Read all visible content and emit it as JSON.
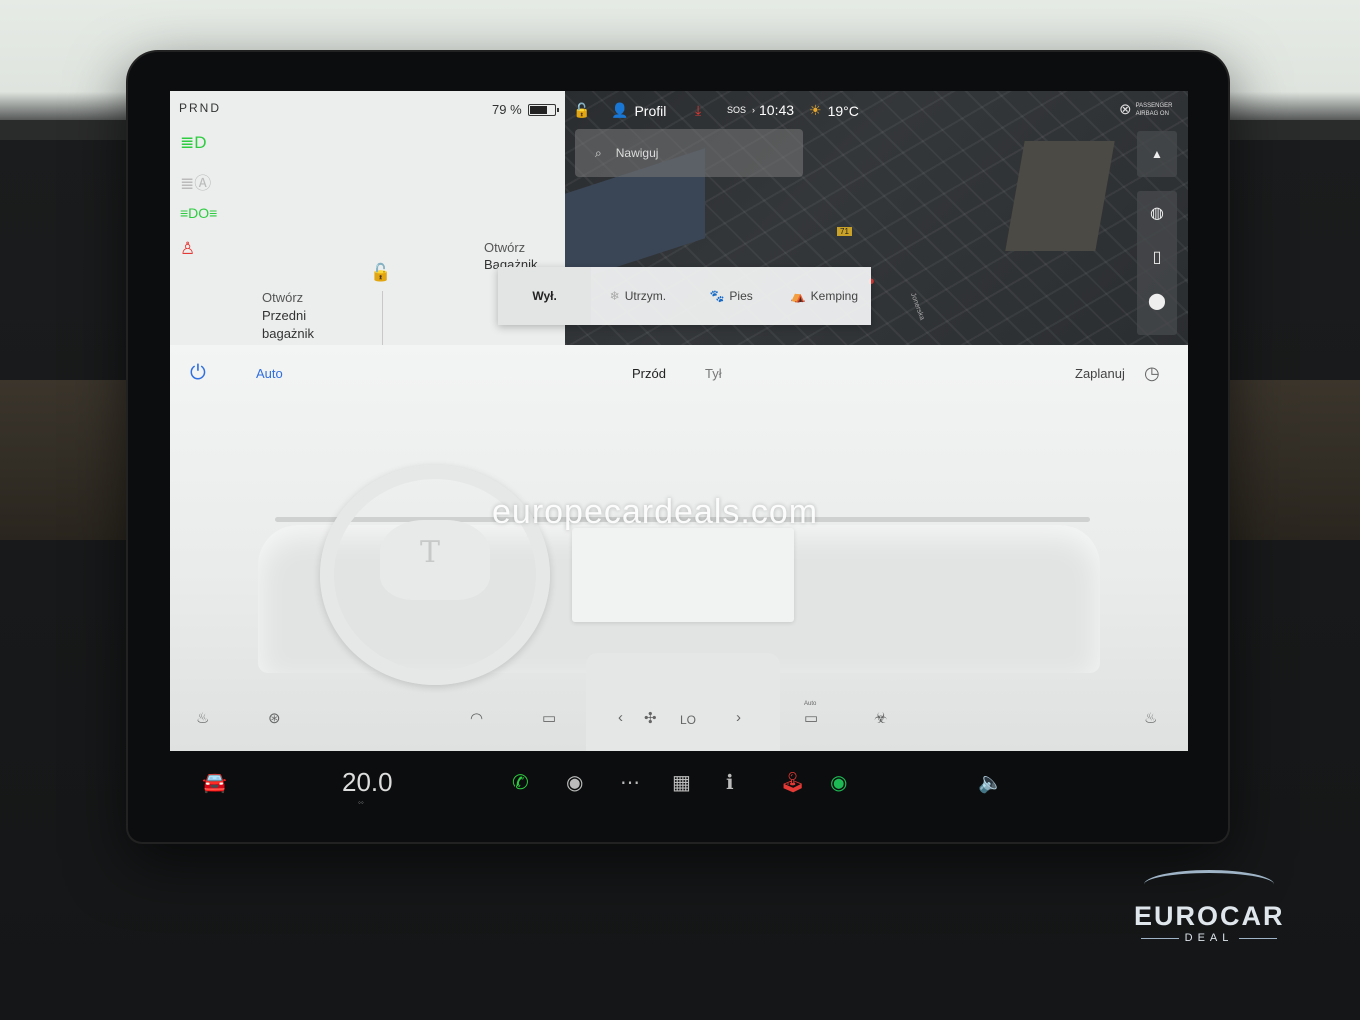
{
  "car_panel": {
    "gear": "PRND",
    "battery_text": "79 %",
    "battery_level": 0.79,
    "front_trunk_line1": "Otwórz",
    "front_trunk_line2": "Przedni",
    "front_trunk_line3": "bagażnik",
    "rear_trunk_line1": "Otwórz",
    "rear_trunk_line2": "Bagażnik"
  },
  "status_bar": {
    "profile_label": "Profil",
    "sos_label": "SOS",
    "time": "10:43",
    "outside_temp": "19°C",
    "passenger_airbag_line1": "PASSENGER",
    "passenger_airbag_line2": "AIRBAG ON"
  },
  "search": {
    "placeholder": "Nawiguj"
  },
  "map": {
    "road_badge": "71",
    "street_label": "Jonerska"
  },
  "climate_modes": {
    "off": "Wył.",
    "keep": "Utrzym.",
    "dog": "Pies",
    "camp": "Kemping"
  },
  "climate": {
    "auto_label": "Auto",
    "front_label": "Przód",
    "rear_label": "Tył",
    "schedule_label": "Zaplanuj",
    "fan_level": "LO",
    "auto_small": "Auto"
  },
  "watermark": "europecardeals.com",
  "taskbar": {
    "temperature": "20.0"
  },
  "logo": {
    "name": "EUROCAR",
    "sub": "DEAL"
  },
  "colors": {
    "accent": "#2f6fe0",
    "green": "#2ecc40",
    "red": "#e53935",
    "spotify": "#1db954"
  }
}
